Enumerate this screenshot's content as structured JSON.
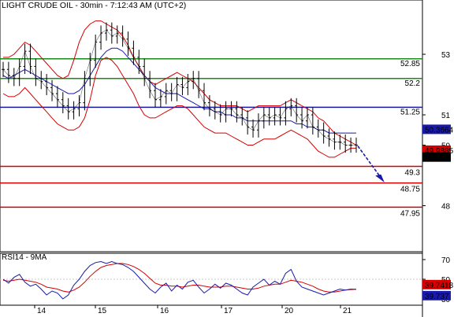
{
  "header": {
    "instrument": "LIGHT CRUDE OIL",
    "timeframe": "30min",
    "time": "7:12:43 AM (UTC+2)",
    "title": "LIGHT CRUDE OIL - 30min - 7:12:43 AM (UTC+2)"
  },
  "colors": {
    "price": "#000000",
    "bollinger": "#d40000",
    "ma": "#1a1aa8",
    "support": "#d40000",
    "resistance": "#1a8a1a",
    "pivot": "#1a1aa8",
    "arrow": "#1a1aa8",
    "rsi": "#1a1aa8",
    "rsi_ma": "#d40000"
  },
  "chart_data": [
    {
      "type": "line",
      "title": "LIGHT CRUDE OIL - 30min - 7:12:43 AM (UTC+2)",
      "x_tick_labels": [
        "14",
        "15",
        "16",
        "17",
        "20",
        "21"
      ],
      "y_tick_labels": [
        "53",
        "51",
        "50",
        "48"
      ],
      "ylim": [
        47.75,
        54.4
      ],
      "horizontal_levels": [
        {
          "label": "52.85",
          "value": 52.85,
          "kind": "resistance"
        },
        {
          "label": "52.2",
          "value": 52.2,
          "kind": "resistance"
        },
        {
          "label": "51.25",
          "value": 51.25,
          "kind": "pivot"
        },
        {
          "label": "49.3",
          "value": 49.3,
          "kind": "support"
        },
        {
          "label": "48.75",
          "value": 48.75,
          "kind": "support"
        },
        {
          "label": "47.95",
          "value": 47.95,
          "kind": "support"
        }
      ],
      "value_badges": [
        {
          "label": "50.3664",
          "value": 50.3664,
          "series": "ma"
        },
        {
          "label": "49.9885",
          "value": 49.9885,
          "series": "bollinger"
        },
        {
          "label": "49.97",
          "value": 49.97,
          "series": "price"
        }
      ],
      "arrow": {
        "from": 49.97,
        "to": 48.75
      },
      "series": [
        {
          "key": "price",
          "values": [
            52.5,
            52.3,
            52.2,
            52.6,
            53.1,
            52.6,
            52.2,
            52.1,
            51.9,
            51.7,
            51.5,
            51.3,
            51.1,
            51.2,
            51.4,
            52.2,
            52.8,
            53.4,
            53.7,
            53.8,
            53.6,
            53.7,
            53.5,
            53.2,
            52.9,
            52.6,
            52.2,
            51.8,
            51.5,
            51.6,
            51.8,
            51.7,
            52.0,
            51.9,
            52.1,
            52.2,
            51.8,
            51.4,
            51.2,
            51.1,
            51.0,
            51.2,
            51.2,
            51.0,
            50.9,
            50.6,
            50.5,
            50.8,
            51.0,
            50.9,
            51.0,
            50.9,
            51.2,
            51.3,
            51.0,
            50.8,
            51.0,
            50.6,
            50.5,
            50.3,
            50.2,
            50.1,
            50.1,
            50.0,
            50.0,
            50.0
          ]
        },
        {
          "key": "bollinger_upper",
          "values": [
            52.9,
            52.9,
            53.0,
            53.2,
            53.4,
            53.3,
            53.1,
            52.9,
            52.7,
            52.5,
            52.3,
            52.2,
            52.3,
            52.8,
            53.4,
            53.8,
            54.0,
            54.1,
            54.1,
            54.0,
            53.9,
            53.8,
            53.6,
            53.3,
            52.9,
            52.6,
            52.3,
            52.1,
            52.0,
            52.1,
            52.2,
            52.3,
            52.4,
            52.3,
            52.2,
            52.1,
            51.9,
            51.7,
            51.5,
            51.4,
            51.3,
            51.3,
            51.3,
            51.3,
            51.2,
            51.1,
            51.2,
            51.3,
            51.3,
            51.3,
            51.3,
            51.3,
            51.4,
            51.5,
            51.4,
            51.3,
            51.2,
            51.1,
            50.9,
            50.8,
            50.6,
            50.4,
            50.3,
            50.2,
            50.1,
            50.0
          ]
        },
        {
          "key": "bollinger_lower",
          "values": [
            51.7,
            51.6,
            51.6,
            51.7,
            51.9,
            51.7,
            51.5,
            51.3,
            51.1,
            50.9,
            50.7,
            50.6,
            50.5,
            50.5,
            50.6,
            50.9,
            51.5,
            52.3,
            52.8,
            52.9,
            52.8,
            52.6,
            52.3,
            52.0,
            51.7,
            51.3,
            51.0,
            50.9,
            50.9,
            51.0,
            51.1,
            51.2,
            51.3,
            51.3,
            51.2,
            51.0,
            50.8,
            50.6,
            50.5,
            50.4,
            50.4,
            50.4,
            50.3,
            50.2,
            50.1,
            50.0,
            50.0,
            50.1,
            50.2,
            50.2,
            50.2,
            50.3,
            50.4,
            50.5,
            50.4,
            50.3,
            50.2,
            50.0,
            49.8,
            49.7,
            49.6,
            49.6,
            49.7,
            49.8,
            49.9,
            49.9
          ]
        },
        {
          "key": "ma",
          "values": [
            52.3,
            52.2,
            52.3,
            52.4,
            52.5,
            52.4,
            52.3,
            52.2,
            52.1,
            52.0,
            51.9,
            51.8,
            51.7,
            51.7,
            51.8,
            52.0,
            52.3,
            52.6,
            52.9,
            53.1,
            53.2,
            53.2,
            53.1,
            52.9,
            52.7,
            52.5,
            52.3,
            52.1,
            51.9,
            51.8,
            51.7,
            51.7,
            51.7,
            51.6,
            51.5,
            51.4,
            51.3,
            51.2,
            51.2,
            51.1,
            51.1,
            51.0,
            51.0,
            50.9,
            50.9,
            50.8,
            50.8,
            50.8,
            50.8,
            50.8,
            50.8,
            50.8,
            50.8,
            50.8,
            50.7,
            50.7,
            50.6,
            50.6,
            50.5,
            50.5,
            50.4,
            50.4,
            50.4,
            50.4,
            50.4,
            50.4
          ]
        }
      ]
    },
    {
      "type": "line",
      "title": "RSI14 - 9MA",
      "y_tick_labels": [
        "70",
        "50",
        "30"
      ],
      "ylim": [
        24,
        76
      ],
      "value_badges": [
        {
          "label": "39.7418",
          "value": 39.7418,
          "series": "rsi_ma"
        },
        {
          "label": "39.737",
          "value": 39.737,
          "series": "rsi"
        }
      ],
      "series": [
        {
          "key": "rsi",
          "values": [
            50,
            46,
            52,
            55,
            47,
            43,
            45,
            40,
            34,
            38,
            36,
            30,
            34,
            44,
            50,
            58,
            64,
            67,
            68,
            66,
            68,
            66,
            65,
            62,
            58,
            52,
            46,
            40,
            36,
            42,
            46,
            38,
            44,
            40,
            47,
            49,
            42,
            36,
            40,
            45,
            41,
            46,
            44,
            40,
            36,
            34,
            42,
            46,
            50,
            44,
            48,
            45,
            56,
            60,
            48,
            42,
            40,
            38,
            36,
            34,
            36,
            38,
            40,
            39,
            40,
            39.737
          ]
        },
        {
          "key": "rsi_ma",
          "values": [
            49,
            48,
            49,
            50,
            49,
            48,
            47,
            45,
            42,
            41,
            40,
            38,
            37,
            39,
            42,
            47,
            53,
            58,
            62,
            64,
            65,
            66,
            66,
            65,
            63,
            60,
            56,
            51,
            46,
            44,
            44,
            43,
            43,
            42,
            43,
            44,
            44,
            43,
            42,
            42,
            42,
            43,
            43,
            42,
            41,
            40,
            40,
            41,
            43,
            44,
            45,
            45,
            47,
            49,
            48,
            47,
            45,
            43,
            40,
            38,
            37,
            37,
            38,
            39,
            39.5,
            39.7418
          ]
        }
      ]
    }
  ],
  "panes": {
    "rsi_title": "RSI14 - 9MA"
  }
}
